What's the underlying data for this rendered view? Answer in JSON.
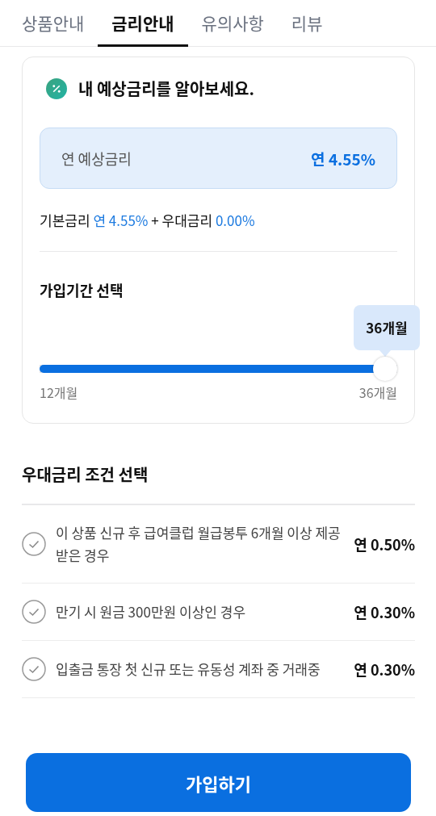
{
  "tabs": [
    {
      "label": "상품안내",
      "selected": false
    },
    {
      "label": "금리안내",
      "selected": true
    },
    {
      "label": "유의사항",
      "selected": false
    },
    {
      "label": "리뷰",
      "selected": false
    }
  ],
  "rate_card": {
    "title": "내 예상금리를 알아보세요.",
    "estimate": {
      "label": "연 예상금리",
      "value": "연 4.55%"
    },
    "breakdown": [
      {
        "kind": "label",
        "text": "기본금리 "
      },
      {
        "kind": "value",
        "text": "연 4.55%"
      },
      {
        "kind": "label",
        "text": " + 우대금리 "
      },
      {
        "kind": "value",
        "text": "0.00%"
      }
    ],
    "period": {
      "title": "가입기간 선택",
      "tooltip": "36개월",
      "level": 1,
      "min_label": "12개월",
      "max_label": "36개월"
    }
  },
  "bonus_conditions": {
    "title": "우대금리 조건 선택",
    "items": [
      {
        "text": "이 상품 신규 후 급여클럽 월급봉투 6개월 이상 제공받은 경우",
        "rate": "연 0.50%",
        "checked": false
      },
      {
        "text": "만기 시 원금 300만원 이상인 경우",
        "rate": "연 0.30%",
        "checked": false
      },
      {
        "text": "입출금 통장 첫 신규 또는 유동성 계좌 중 거래중",
        "rate": "연 0.30%",
        "checked": false
      }
    ]
  },
  "join_button": "가입하기"
}
